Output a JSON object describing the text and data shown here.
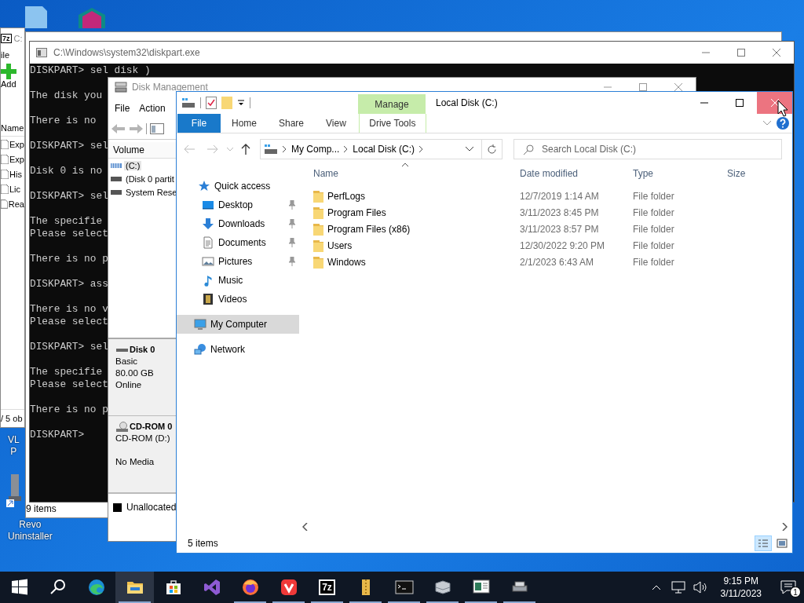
{
  "desktop_labels": [
    {
      "kind": "media",
      "lines": [
        "VL",
        "P"
      ]
    },
    {
      "kind": "uninstaller",
      "lines": [
        "Revo",
        "Uninstaller"
      ]
    }
  ],
  "archive_window": {
    "badge": "7z",
    "title": "C:",
    "menu": "ile",
    "toolbar": "Add",
    "column": "Name",
    "rows": [
      "Exp",
      "Exp",
      "His",
      "Lic",
      "Rea"
    ],
    "status": "/ 5 ob"
  },
  "background_window": {
    "status": "9 items"
  },
  "console_window": {
    "title": "C:\\Windows\\system32\\diskpart.exe",
    "blocks": [
      [
        "DISKPART> sel disk )"
      ],
      [
        "The disk you"
      ],
      [
        "There is no"
      ],
      [
        "DISKPART> sel"
      ],
      [
        "Disk 0 is no"
      ],
      [
        "DISKPART> sel"
      ],
      [
        "The specifie",
        "Please select"
      ],
      [
        "There is no p"
      ],
      [
        "DISKPART> ass"
      ],
      [
        "There is no v",
        "Please select"
      ],
      [
        "DISKPART> sel"
      ],
      [
        "The specifie",
        "Please select"
      ],
      [
        "There is no p"
      ],
      [
        "DISKPART>"
      ]
    ]
  },
  "disk_management": {
    "title": "Disk Management",
    "menu": [
      "File",
      "Action"
    ],
    "volume_header": "Volume",
    "volumes": [
      {
        "name": "(C:)",
        "kind": "striped",
        "selected": true
      },
      {
        "name": "(Disk 0 partit",
        "kind": "plain",
        "selected": false
      },
      {
        "name": "System Rese",
        "kind": "plain",
        "selected": false
      }
    ],
    "disks": [
      {
        "kind": "disk",
        "name": "Disk 0",
        "blocks": [
          [
            "Basic",
            "80.00 GB",
            "Online"
          ]
        ]
      },
      {
        "kind": "cdrom",
        "name": "CD-ROM 0",
        "blocks": [
          [
            "CD-ROM (D:)"
          ],
          [
            "No Media"
          ]
        ]
      }
    ],
    "legend": "Unallocated"
  },
  "explorer": {
    "title": "Local Disk (C:)",
    "close_hovered": true,
    "context_tab": "Manage",
    "ribbon_tabs": [
      {
        "label": "File",
        "kind": "file"
      },
      {
        "label": "Home",
        "kind": "plain"
      },
      {
        "label": "Share",
        "kind": "plain"
      },
      {
        "label": "View",
        "kind": "plain"
      },
      {
        "label": "Drive Tools",
        "kind": "context"
      }
    ],
    "breadcrumbs": [
      "My Comp...",
      "Local Disk (C:)"
    ],
    "search": {
      "placeholder": "Search Local Disk (C:)"
    },
    "nav": [
      {
        "label": "Quick access",
        "kind": "star",
        "selected": false,
        "children": [
          {
            "label": "Desktop",
            "kind": "desktop",
            "pinned": true,
            "selected": false
          },
          {
            "label": "Downloads",
            "kind": "download",
            "pinned": true,
            "selected": false
          },
          {
            "label": "Documents",
            "kind": "documents",
            "pinned": true,
            "selected": false
          },
          {
            "label": "Pictures",
            "kind": "pictures",
            "pinned": true,
            "selected": false
          },
          {
            "label": "Music",
            "kind": "music",
            "pinned": false,
            "selected": false
          },
          {
            "label": "Videos",
            "kind": "videos",
            "pinned": false,
            "selected": false
          }
        ]
      },
      {
        "label": "My Computer",
        "kind": "computer",
        "selected": true
      },
      {
        "label": "Network",
        "kind": "network",
        "selected": false
      }
    ],
    "columns": [
      {
        "label": "Name",
        "sorted": true
      },
      {
        "label": "Date modified",
        "sorted": false
      },
      {
        "label": "Type",
        "sorted": false
      },
      {
        "label": "Size",
        "sorted": false
      }
    ],
    "rows": [
      {
        "name": "PerfLogs",
        "date": "12/7/2019 1:14 AM",
        "type": "File folder"
      },
      {
        "name": "Program Files",
        "date": "3/11/2023 8:45 PM",
        "type": "File folder"
      },
      {
        "name": "Program Files (x86)",
        "date": "3/11/2023 8:57 PM",
        "type": "File folder"
      },
      {
        "name": "Users",
        "date": "12/30/2022 9:20 PM",
        "type": "File folder"
      },
      {
        "name": "Windows",
        "date": "2/1/2023 6:43 AM",
        "type": "File folder"
      }
    ],
    "status": "5 items",
    "views": [
      {
        "kind": "details",
        "selected": true
      },
      {
        "kind": "large-icons",
        "selected": false
      }
    ]
  },
  "taskbar": {
    "items": [
      {
        "kind": "start",
        "selected": false,
        "running": false
      },
      {
        "kind": "search",
        "selected": false,
        "running": false
      },
      {
        "kind": "edge",
        "selected": false,
        "running": false
      },
      {
        "kind": "explorer",
        "selected": true,
        "running": true
      },
      {
        "kind": "store",
        "selected": false,
        "running": false
      },
      {
        "kind": "studio",
        "selected": false,
        "running": false
      },
      {
        "kind": "firefox",
        "selected": false,
        "running": true
      },
      {
        "kind": "vivaldi",
        "selected": false,
        "running": true
      },
      {
        "kind": "archiver",
        "text": "7z",
        "selected": false,
        "running": true
      },
      {
        "kind": "zip-folder",
        "selected": false,
        "running": true
      },
      {
        "kind": "terminal",
        "selected": false,
        "running": true
      },
      {
        "kind": "disk-tool",
        "selected": false,
        "running": true
      },
      {
        "kind": "monitor",
        "selected": false,
        "running": true
      },
      {
        "kind": "drives",
        "selected": false,
        "running": true
      }
    ],
    "time": "9:15 PM",
    "date": "3/11/2023",
    "notifications": "1"
  }
}
